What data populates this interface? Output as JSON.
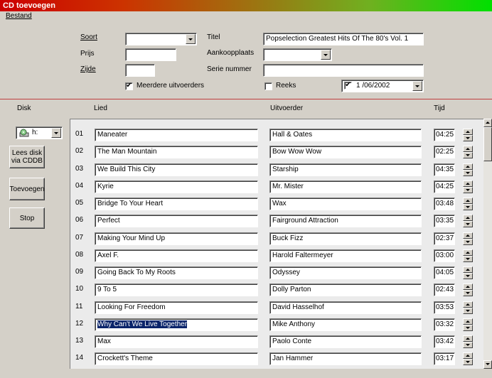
{
  "window": {
    "title": "CD toevoegen"
  },
  "menu": {
    "bestand": "Bestand"
  },
  "form": {
    "soort_label": "Soort",
    "soort_value": "",
    "prijs_label": "Prijs",
    "prijs_value": "",
    "zijde_label": "Zijde",
    "zijde_value": "",
    "meerdere_label": "Meerdere uitvoerders",
    "meerdere_checked": true,
    "titel_label": "Titel",
    "titel_value": "Popselection Greatest Hits Of The 80's Vol. 1",
    "aankoopplaats_label": "Aankoopplaats",
    "aankoopplaats_value": "",
    "serie_label": "Serie nummer",
    "serie_value": "",
    "reeks_label": "Reeks",
    "reeks_checked": false,
    "date_checked": true,
    "date_value": "1 /06/2002"
  },
  "columns": {
    "disk": "Disk",
    "lied": "Lied",
    "uitvoerder": "Uitvoerder",
    "tijd": "Tijd"
  },
  "disk": {
    "drive_value": "h:",
    "drive_icon": "cd-drive-icon",
    "lees_disk": "Lees disk via CDDB",
    "toevoegen": "Toevoegen",
    "stop": "Stop"
  },
  "tracks": [
    {
      "num": "01",
      "song": "Maneater",
      "artist": "Hall & Oates",
      "time": "04:25"
    },
    {
      "num": "02",
      "song": "The Man Mountain",
      "artist": "Bow Wow Wow",
      "time": "02:25"
    },
    {
      "num": "03",
      "song": "We Build This City",
      "artist": "Starship",
      "time": "04:35"
    },
    {
      "num": "04",
      "song": "Kyrie",
      "artist": "Mr. Mister",
      "time": "04:25"
    },
    {
      "num": "05",
      "song": "Bridge To Your Heart",
      "artist": "Wax",
      "time": "03:48"
    },
    {
      "num": "06",
      "song": "Perfect",
      "artist": "Fairground Attraction",
      "time": "03:35"
    },
    {
      "num": "07",
      "song": "Making Your Mind Up",
      "artist": "Buck Fizz",
      "time": "02:37"
    },
    {
      "num": "08",
      "song": "Axel F.",
      "artist": "Harold Faltermeyer",
      "time": "03:00"
    },
    {
      "num": "09",
      "song": "Going Back To My Roots",
      "artist": "Odyssey",
      "time": "04:05"
    },
    {
      "num": "10",
      "song": "9 To 5",
      "artist": "Dolly Parton",
      "time": "02:43"
    },
    {
      "num": "11",
      "song": "Looking For Freedom",
      "artist": "David Hasselhof",
      "time": "03:53"
    },
    {
      "num": "12",
      "song": "Why Can't We Live Together",
      "artist": "Mike Anthony",
      "time": "03:32",
      "selected": true
    },
    {
      "num": "13",
      "song": "Max",
      "artist": "Paolo Conte",
      "time": "03:42"
    },
    {
      "num": "14",
      "song": "Crockett's Theme",
      "artist": "Jan Hammer",
      "time": "03:17"
    }
  ],
  "colors": {
    "title_start": "#cc0000",
    "title_end": "#00e000",
    "separator": "#c04040",
    "selection": "#0a246a"
  }
}
